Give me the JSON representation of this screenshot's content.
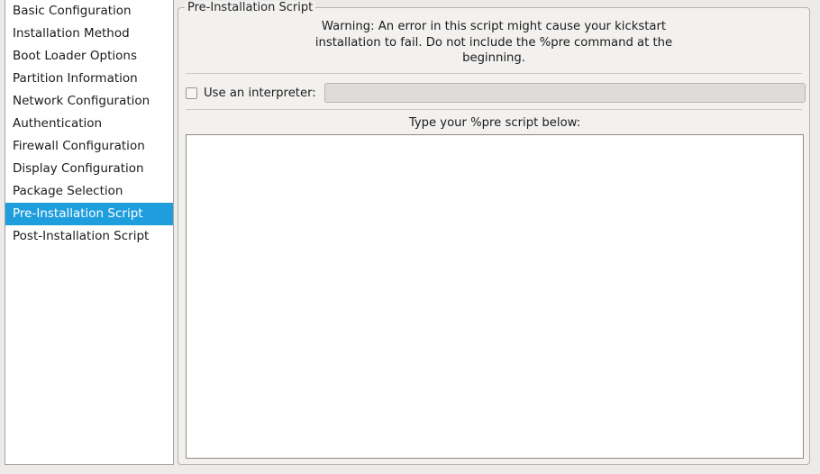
{
  "sidebar": {
    "items": [
      {
        "label": "Basic Configuration",
        "selected": false
      },
      {
        "label": "Installation Method",
        "selected": false
      },
      {
        "label": "Boot Loader Options",
        "selected": false
      },
      {
        "label": "Partition Information",
        "selected": false
      },
      {
        "label": "Network Configuration",
        "selected": false
      },
      {
        "label": "Authentication",
        "selected": false
      },
      {
        "label": "Firewall Configuration",
        "selected": false
      },
      {
        "label": "Display Configuration",
        "selected": false
      },
      {
        "label": "Package Selection",
        "selected": false
      },
      {
        "label": "Pre-Installation Script",
        "selected": true
      },
      {
        "label": "Post-Installation Script",
        "selected": false
      }
    ],
    "selection_color": "#1f9ede",
    "selection_text_color": "#ffffff"
  },
  "panel": {
    "title": "Pre-Installation Script",
    "warning_line1": "Warning: An error in this script might cause your kickstart",
    "warning_line2": "installation to fail. Do not include the %pre command at the",
    "warning_line3": "beginning.",
    "interpreter": {
      "checkbox_label": "Use an interpreter:",
      "checked": false,
      "input_value": "",
      "input_placeholder": ""
    },
    "script_label": "Type your %pre script below:",
    "script_value": "",
    "script_placeholder": ""
  },
  "colors": {
    "page_background": "#edebe9",
    "panel_background": "#f2f1f0",
    "field_background": "#ffffff",
    "disabled_field_background": "#dedbd8",
    "border": "#b6b2ae"
  }
}
